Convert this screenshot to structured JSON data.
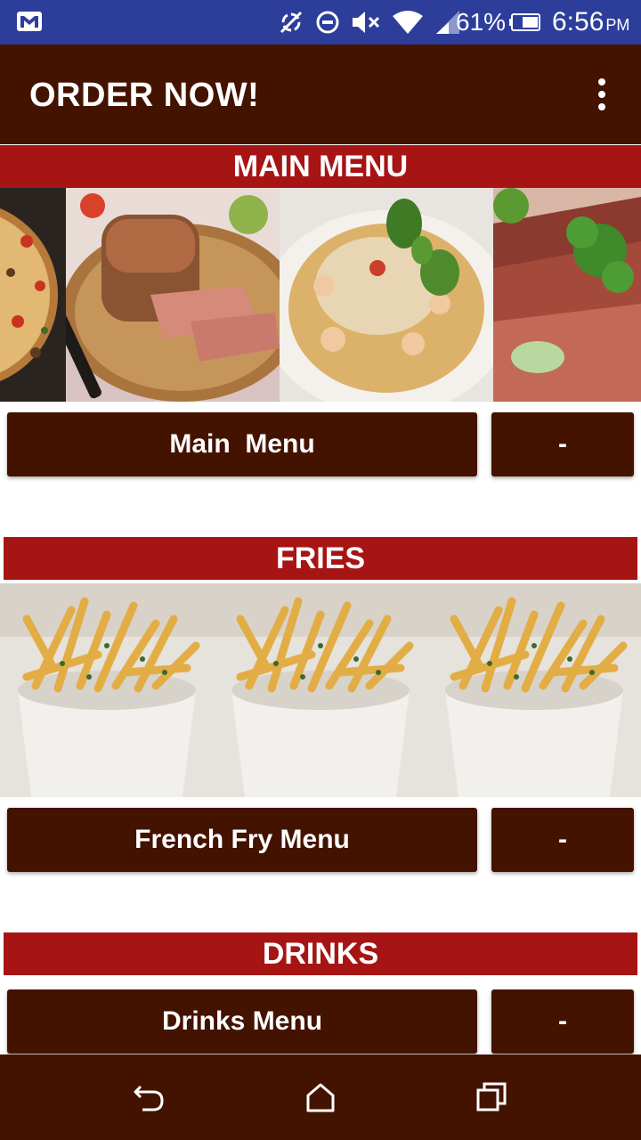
{
  "status_bar": {
    "battery_percent": "61%",
    "time": "6:56",
    "ampm": "PM",
    "icons": [
      "gmail-icon",
      "sync-off-icon",
      "do-not-disturb-icon",
      "volume-muted-icon",
      "wifi-icon",
      "cell-signal-icon",
      "battery-icon"
    ]
  },
  "app_bar": {
    "title": "ORDER NOW!",
    "overflow_icon": "more-vert-icon"
  },
  "sections": [
    {
      "header": "MAIN MENU",
      "button_label": "Main  Menu",
      "side_button_label": "-"
    },
    {
      "header": "FRIES",
      "button_label": "French Fry Menu",
      "side_button_label": "-"
    },
    {
      "header": "DRINKS",
      "button_label": "Drinks Menu",
      "side_button_label": "-"
    }
  ],
  "nav_bar": {
    "icons": [
      "back-icon",
      "home-icon",
      "recents-icon"
    ]
  },
  "colors": {
    "status_bar": "#2d3e9a",
    "app_bar": "#431300",
    "section_header": "#a71414",
    "button": "#431300",
    "text": "#ffffff"
  }
}
